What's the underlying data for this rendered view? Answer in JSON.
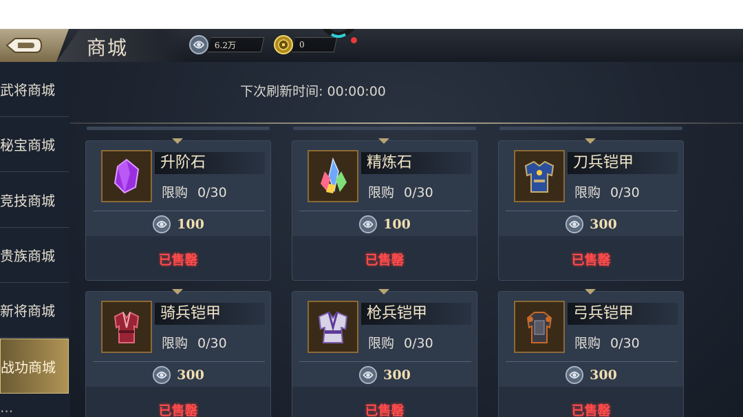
{
  "header": {
    "title": "商城",
    "currency_silver": "6.2万",
    "currency_gold": "0"
  },
  "sidebar": {
    "items": [
      {
        "label": "武将商城"
      },
      {
        "label": "秘宝商城"
      },
      {
        "label": "竞技商城"
      },
      {
        "label": "贵族商城"
      },
      {
        "label": "新将商城"
      },
      {
        "label": "战功商城",
        "active": true
      },
      {
        "label": "..."
      }
    ]
  },
  "main": {
    "refresh_label": "下次刷新时间:",
    "refresh_time": "00:00:00"
  },
  "shop": {
    "limit_label": "限购",
    "items": [
      {
        "name": "升阶石",
        "limit": "0/30",
        "price": "100",
        "status": "已售罄",
        "icon": "purple-crystal-icon"
      },
      {
        "name": "精炼石",
        "limit": "0/30",
        "price": "100",
        "status": "已售罄",
        "icon": "rainbow-crystal-icon"
      },
      {
        "name": "刀兵铠甲",
        "limit": "0/30",
        "price": "300",
        "status": "已售罄",
        "icon": "blue-armor-icon"
      },
      {
        "name": "骑兵铠甲",
        "limit": "0/30",
        "price": "300",
        "status": "已售罄",
        "icon": "red-robe-icon"
      },
      {
        "name": "枪兵铠甲",
        "limit": "0/30",
        "price": "300",
        "status": "已售罄",
        "icon": "purple-robe-icon"
      },
      {
        "name": "弓兵铠甲",
        "limit": "0/30",
        "price": "300",
        "status": "已售罄",
        "icon": "dark-armor-icon"
      }
    ]
  },
  "colors": {
    "accent_gold": "#b09455",
    "sold_out_red": "#ff4b4b",
    "price_text": "#f1deb0",
    "card_bg": "#2f3a4b"
  }
}
